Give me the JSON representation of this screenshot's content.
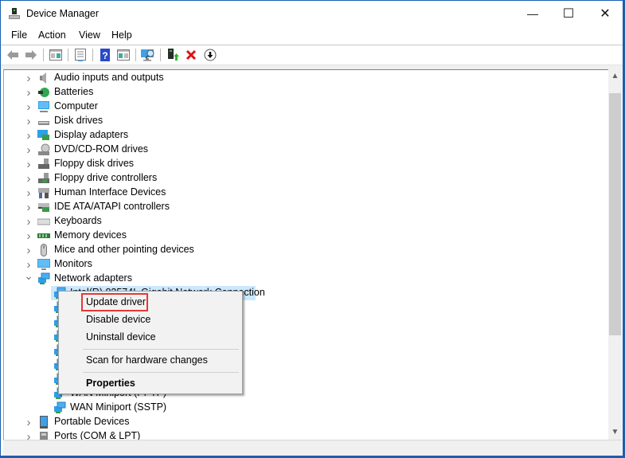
{
  "window": {
    "title": "Device Manager",
    "controls": {
      "minimize": "—",
      "maximize": "☐",
      "close": "✕"
    }
  },
  "menubar": {
    "items": [
      "File",
      "Action",
      "View",
      "Help"
    ]
  },
  "toolbar": {
    "buttons": [
      "back",
      "forward",
      "show-hide-console-tree",
      "properties",
      "help",
      "show-hide-action-pane",
      "scan-for-hardware-changes",
      "update-driver",
      "uninstall-device",
      "disable-device"
    ]
  },
  "tree": {
    "categories": [
      {
        "label": "Audio inputs and outputs",
        "icon": "speaker-icon",
        "expanded": false
      },
      {
        "label": "Batteries",
        "icon": "battery-icon",
        "expanded": false
      },
      {
        "label": "Computer",
        "icon": "computer-icon",
        "expanded": false
      },
      {
        "label": "Disk drives",
        "icon": "disk-drive-icon",
        "expanded": false
      },
      {
        "label": "Display adapters",
        "icon": "display-adapter-icon",
        "expanded": false
      },
      {
        "label": "DVD/CD-ROM drives",
        "icon": "dvd-drive-icon",
        "expanded": false
      },
      {
        "label": "Floppy disk drives",
        "icon": "floppy-drive-icon",
        "expanded": false
      },
      {
        "label": "Floppy drive controllers",
        "icon": "floppy-controller-icon",
        "expanded": false
      },
      {
        "label": "Human Interface Devices",
        "icon": "hid-icon",
        "expanded": false
      },
      {
        "label": "IDE ATA/ATAPI controllers",
        "icon": "ide-controller-icon",
        "expanded": false
      },
      {
        "label": "Keyboards",
        "icon": "keyboard-icon",
        "expanded": false
      },
      {
        "label": "Memory devices",
        "icon": "memory-icon",
        "expanded": false
      },
      {
        "label": "Mice and other pointing devices",
        "icon": "mouse-icon",
        "expanded": false
      },
      {
        "label": "Monitors",
        "icon": "monitor-icon",
        "expanded": false
      },
      {
        "label": "Network adapters",
        "icon": "network-adapter-icon",
        "expanded": true
      }
    ],
    "network_children": [
      {
        "label": "Intel(R) 82574L Gigabit Network Connection",
        "selected": true
      },
      {
        "label": ""
      },
      {
        "label": ""
      },
      {
        "label": ""
      },
      {
        "label": ""
      },
      {
        "label": ""
      },
      {
        "label": ""
      },
      {
        "label": "WAN Miniport (PPTP)"
      },
      {
        "label": "WAN Miniport (SSTP)"
      }
    ],
    "after": [
      {
        "label": "Portable Devices",
        "icon": "portable-device-icon",
        "expanded": false
      },
      {
        "label": "Ports (COM & LPT)",
        "icon": "port-icon",
        "expanded": false
      }
    ]
  },
  "context_menu": {
    "items": [
      {
        "label": "Update driver",
        "highlighted": true
      },
      {
        "label": "Disable device"
      },
      {
        "label": "Uninstall device"
      },
      {
        "label": "Scan for hardware changes"
      },
      {
        "label": "Properties",
        "bold": true
      }
    ],
    "highlight_color": "#e53935"
  }
}
